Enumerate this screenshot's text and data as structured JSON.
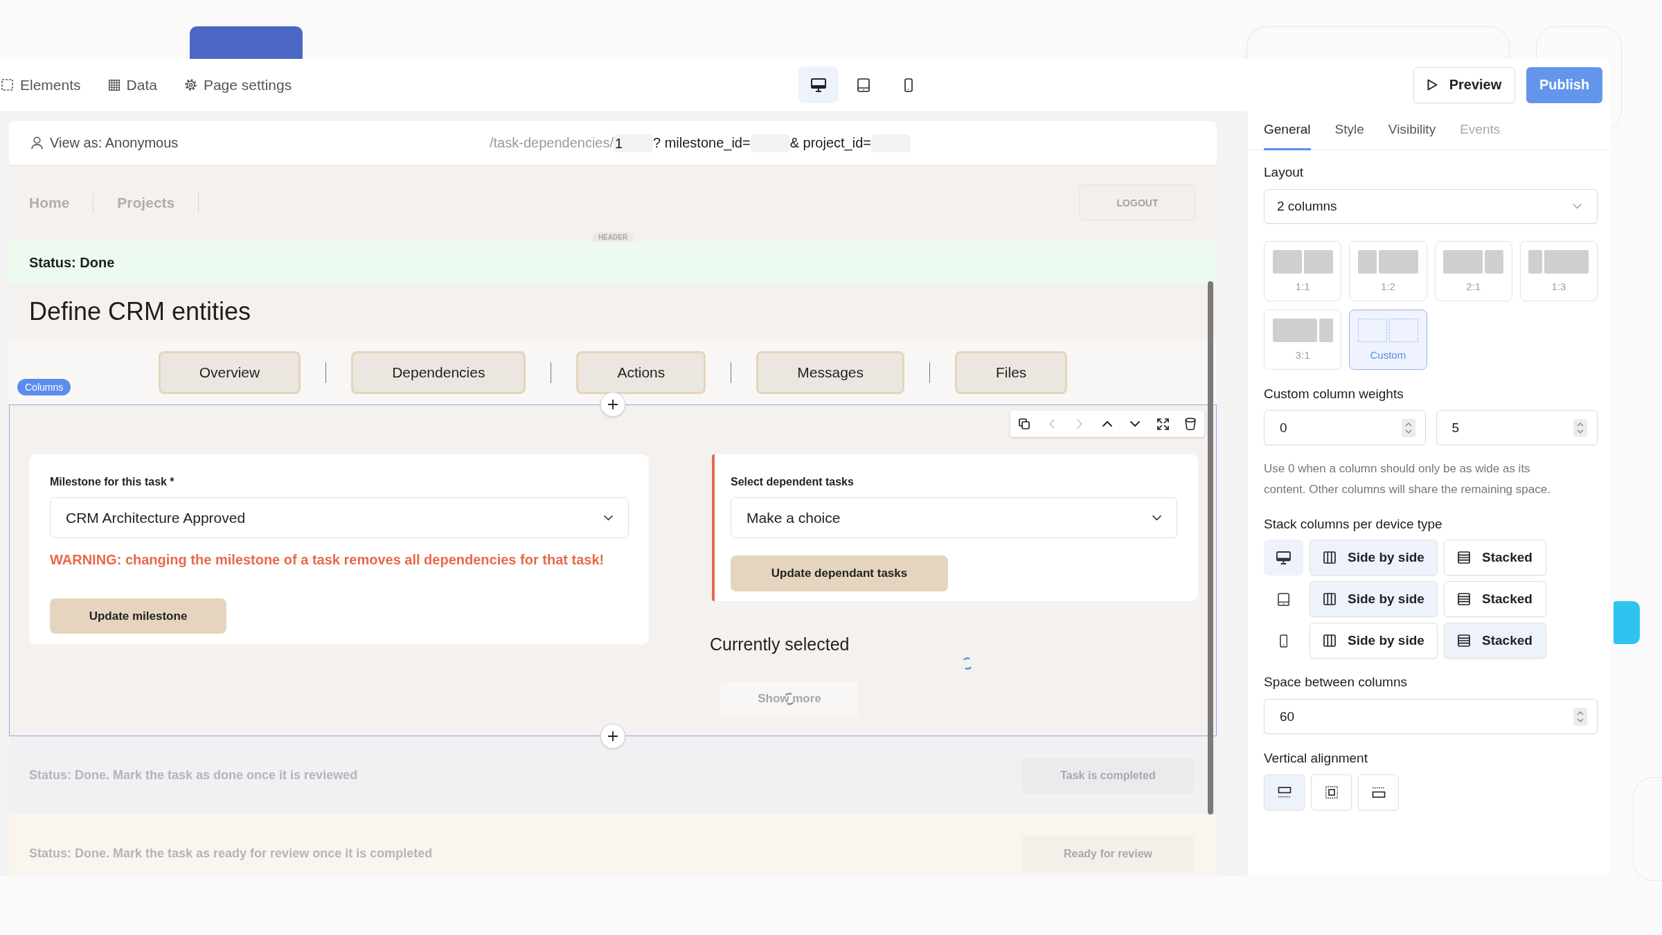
{
  "toolbar": {
    "items": [
      {
        "kind": "elements",
        "label": "Elements"
      },
      {
        "kind": "data",
        "label": "Data"
      },
      {
        "kind": "settings",
        "label": "Page settings"
      }
    ],
    "devices": [
      {
        "kind": "desktop",
        "selected": true
      },
      {
        "kind": "tablet",
        "selected": false
      },
      {
        "kind": "mobile",
        "selected": false
      }
    ],
    "preview_button": "Preview",
    "publish_button": "Publish"
  },
  "canvas": {
    "view_as": "View as: Anonymous",
    "url": [
      {
        "kind": "path",
        "text": "/task-dependencies/"
      },
      {
        "kind": "field",
        "value": "1"
      },
      {
        "kind": "text",
        "text": "? milestone_id="
      },
      {
        "kind": "field"
      },
      {
        "kind": "text",
        "text": "& project_id="
      },
      {
        "kind": "field"
      }
    ],
    "header": {
      "nav": [
        "Home",
        "Projects"
      ],
      "logout_button": "LOGOUT",
      "label": "HEADER"
    },
    "status": "Status: Done",
    "title": "Define CRM entities",
    "tabs": [
      {
        "label": "Overview",
        "selected": false
      },
      {
        "label": "Dependencies",
        "selected": false
      },
      {
        "label": "Actions",
        "selected": false
      },
      {
        "label": "Messages",
        "selected": false
      },
      {
        "label": "Files",
        "selected": false
      }
    ],
    "columns_block": {
      "badge": "Columns",
      "toolbar": [
        {
          "kind": "duplicate",
          "disabled": false
        },
        {
          "kind": "left",
          "disabled": true
        },
        {
          "kind": "right",
          "disabled": true
        },
        {
          "kind": "up",
          "disabled": false
        },
        {
          "kind": "down",
          "disabled": false
        },
        {
          "kind": "expand",
          "disabled": false
        },
        {
          "kind": "delete",
          "disabled": false
        }
      ],
      "milestone_card": {
        "label": "Milestone for this task *",
        "value": "CRM Architecture Approved",
        "warning": "WARNING: changing the milestone of a task removes all dependencies for that task!",
        "button": "Update milestone"
      },
      "dependencies_card": {
        "label": "Select dependent tasks",
        "value": "Make a choice",
        "button": "Update dependant tasks"
      },
      "currently_selected": "Currently selected",
      "show_more_button": "Show more"
    },
    "status_rows": [
      {
        "text": "Status: Done. Mark the task as done once it is reviewed",
        "button": "Task is completed",
        "color": "#f1f1f4"
      },
      {
        "text": "Status: Done. Mark the task as ready for review once it is completed",
        "button": "Ready for review",
        "color": "#faf6ef"
      }
    ]
  },
  "inspector": {
    "tabs": [
      {
        "label": "General",
        "selected": true,
        "disabled": false
      },
      {
        "label": "Style",
        "selected": false,
        "disabled": false
      },
      {
        "label": "Visibility",
        "selected": false,
        "disabled": false
      },
      {
        "label": "Events",
        "selected": false,
        "disabled": true
      }
    ],
    "layout": {
      "label": "Layout",
      "value": "2 columns"
    },
    "ratios": [
      {
        "kind": "one-one",
        "label": "1:1",
        "selected": false
      },
      {
        "kind": "one-two",
        "label": "1:2",
        "selected": false
      },
      {
        "kind": "two-one",
        "label": "2:1",
        "selected": false
      },
      {
        "kind": "one-three",
        "label": "1:3",
        "selected": false
      },
      {
        "kind": "three-one",
        "label": "3:1",
        "selected": false
      },
      {
        "kind": "custom",
        "label": "Custom",
        "selected": true
      }
    ],
    "custom_weights": {
      "label": "Custom column weights",
      "values": [
        "0",
        "5"
      ],
      "help": "Use 0 when a column should only be as wide as its content. Other columns will share the remaining space."
    },
    "stacking": {
      "label": "Stack columns per device type",
      "rows": [
        {
          "kind": "desktop",
          "selected": true,
          "options": [
            {
              "kind": "side",
              "label": "Side by side",
              "selected": true
            },
            {
              "kind": "stacked",
              "label": "Stacked",
              "selected": false
            }
          ]
        },
        {
          "kind": "tablet",
          "selected": false,
          "options": [
            {
              "kind": "side",
              "label": "Side by side",
              "selected": true
            },
            {
              "kind": "stacked",
              "label": "Stacked",
              "selected": false
            }
          ]
        },
        {
          "kind": "mobile",
          "selected": false,
          "options": [
            {
              "kind": "side",
              "label": "Side by side",
              "selected": false
            },
            {
              "kind": "stacked",
              "label": "Stacked",
              "selected": true
            }
          ]
        }
      ]
    },
    "spacing": {
      "label": "Space between columns",
      "value": "60"
    },
    "vertical_alignment": {
      "label": "Vertical alignment",
      "options": [
        {
          "kind": "top",
          "selected": true
        },
        {
          "kind": "center",
          "selected": false
        },
        {
          "kind": "bottom",
          "selected": false
        }
      ]
    }
  }
}
